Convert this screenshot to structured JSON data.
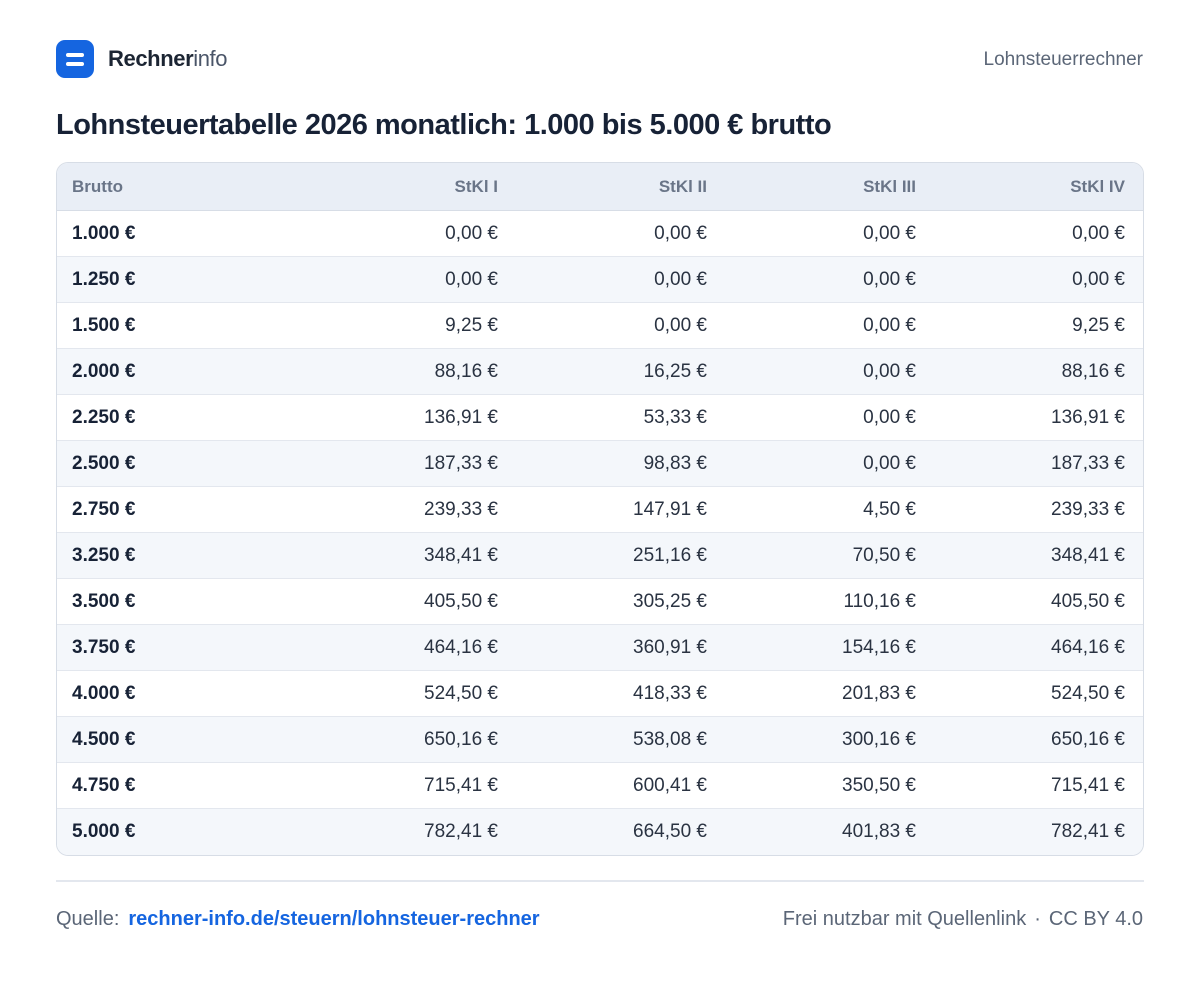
{
  "header": {
    "brand_bold": "Rechner",
    "brand_light": "info",
    "logo_icon": "equals-logo-icon",
    "brand_color": "#1565e0",
    "top_right_label": "Lohnsteuerrechner"
  },
  "title": "Lohnsteuertabelle 2026 monatlich: 1.000 bis 5.000 € brutto",
  "table": {
    "columns": [
      "Brutto",
      "StKl I",
      "StKl II",
      "StKl III",
      "StKl IV"
    ],
    "rows": [
      [
        "1.000 €",
        "0,00 €",
        "0,00 €",
        "0,00 €",
        "0,00 €"
      ],
      [
        "1.250 €",
        "0,00 €",
        "0,00 €",
        "0,00 €",
        "0,00 €"
      ],
      [
        "1.500 €",
        "9,25 €",
        "0,00 €",
        "0,00 €",
        "9,25 €"
      ],
      [
        "2.000 €",
        "88,16 €",
        "16,25 €",
        "0,00 €",
        "88,16 €"
      ],
      [
        "2.250 €",
        "136,91 €",
        "53,33 €",
        "0,00 €",
        "136,91 €"
      ],
      [
        "2.500 €",
        "187,33 €",
        "98,83 €",
        "0,00 €",
        "187,33 €"
      ],
      [
        "2.750 €",
        "239,33 €",
        "147,91 €",
        "4,50 €",
        "239,33 €"
      ],
      [
        "3.250 €",
        "348,41 €",
        "251,16 €",
        "70,50 €",
        "348,41 €"
      ],
      [
        "3.500 €",
        "405,50 €",
        "305,25 €",
        "110,16 €",
        "405,50 €"
      ],
      [
        "3.750 €",
        "464,16 €",
        "360,91 €",
        "154,16 €",
        "464,16 €"
      ],
      [
        "4.000 €",
        "524,50 €",
        "418,33 €",
        "201,83 €",
        "524,50 €"
      ],
      [
        "4.500 €",
        "650,16 €",
        "538,08 €",
        "300,16 €",
        "650,16 €"
      ],
      [
        "4.750 €",
        "715,41 €",
        "600,41 €",
        "350,50 €",
        "715,41 €"
      ],
      [
        "5.000 €",
        "782,41 €",
        "664,50 €",
        "401,83 €",
        "782,41 €"
      ]
    ]
  },
  "footer": {
    "source_label": "Quelle:",
    "source_link": "rechner-info.de/steuern/lohnsteuer-rechner",
    "license_text": "Frei nutzbar mit Quellenlink",
    "license_separator": "·",
    "license_name": "CC BY 4.0"
  }
}
